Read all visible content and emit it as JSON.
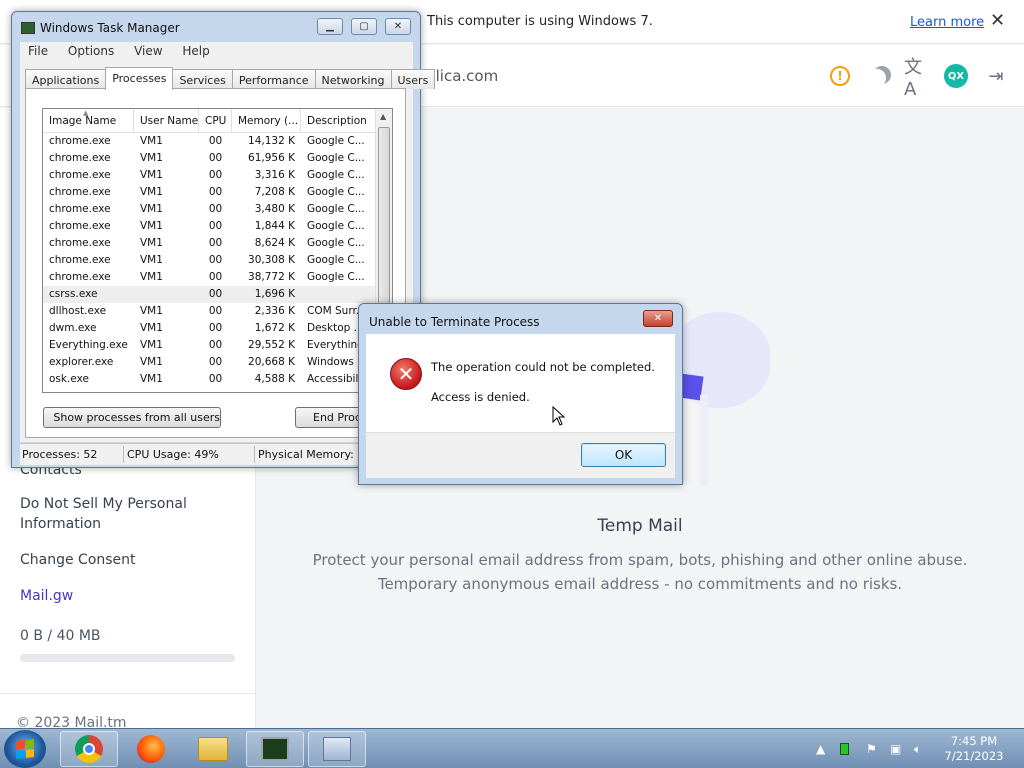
{
  "browser": {
    "notice": {
      "text": "This computer is using Windows 7.",
      "link": "Learn more",
      "close_glyph": "✕"
    },
    "header": {
      "domain_partial": "xelica.com",
      "avatar_initials": "QX",
      "icons": [
        "warning-icon",
        "moon-icon",
        "translate-icon",
        "avatar",
        "logout-icon"
      ]
    },
    "sidebar": {
      "contacts": "Contacts",
      "do_not_sell": "Do Not Sell My Personal Information",
      "change_consent": "Change Consent",
      "mail_gw": "Mail.gw",
      "storage": "0 B  / 40 MB",
      "storage_fraction": 0,
      "copyright": "© 2023 Mail.tm"
    },
    "main": {
      "title": "Temp Mail",
      "desc_line1": "Protect your personal email address from spam, bots, phishing and other online abuse.",
      "desc_line2": "Temporary anonymous email address - no commitments and no risks."
    }
  },
  "task_manager": {
    "title": "Windows Task Manager",
    "menu": [
      "File",
      "Options",
      "View",
      "Help"
    ],
    "tabs": [
      "Applications",
      "Processes",
      "Services",
      "Performance",
      "Networking",
      "Users"
    ],
    "active_tab": "Processes",
    "columns": [
      "Image Name",
      "User Name",
      "CPU",
      "Memory (...",
      "Description"
    ],
    "rows": [
      {
        "name": "chrome.exe",
        "user": "VM1",
        "cpu": "00",
        "mem": "14,132 K",
        "desc": "Google C..."
      },
      {
        "name": "chrome.exe",
        "user": "VM1",
        "cpu": "00",
        "mem": "61,956 K",
        "desc": "Google C..."
      },
      {
        "name": "chrome.exe",
        "user": "VM1",
        "cpu": "00",
        "mem": "3,316 K",
        "desc": "Google C..."
      },
      {
        "name": "chrome.exe",
        "user": "VM1",
        "cpu": "00",
        "mem": "7,208 K",
        "desc": "Google C..."
      },
      {
        "name": "chrome.exe",
        "user": "VM1",
        "cpu": "00",
        "mem": "3,480 K",
        "desc": "Google C..."
      },
      {
        "name": "chrome.exe",
        "user": "VM1",
        "cpu": "00",
        "mem": "1,844 K",
        "desc": "Google C..."
      },
      {
        "name": "chrome.exe",
        "user": "VM1",
        "cpu": "00",
        "mem": "8,624 K",
        "desc": "Google C..."
      },
      {
        "name": "chrome.exe",
        "user": "VM1",
        "cpu": "00",
        "mem": "30,308 K",
        "desc": "Google C..."
      },
      {
        "name": "chrome.exe",
        "user": "VM1",
        "cpu": "00",
        "mem": "38,772 K",
        "desc": "Google C..."
      },
      {
        "name": "csrss.exe",
        "user": "",
        "cpu": "00",
        "mem": "1,696 K",
        "desc": "",
        "selected": true
      },
      {
        "name": "dllhost.exe",
        "user": "VM1",
        "cpu": "00",
        "mem": "2,336 K",
        "desc": "COM Surr..."
      },
      {
        "name": "dwm.exe",
        "user": "VM1",
        "cpu": "00",
        "mem": "1,672 K",
        "desc": "Desktop ..."
      },
      {
        "name": "Everything.exe",
        "user": "VM1",
        "cpu": "00",
        "mem": "29,552 K",
        "desc": "Everything"
      },
      {
        "name": "explorer.exe",
        "user": "VM1",
        "cpu": "00",
        "mem": "20,668 K",
        "desc": "Windows ..."
      },
      {
        "name": "osk.exe",
        "user": "VM1",
        "cpu": "00",
        "mem": "4,588 K",
        "desc": "Accessibili..."
      }
    ],
    "show_all_button": "Show processes from all users",
    "end_process_button": "End Process",
    "status": {
      "processes": "Processes: 52",
      "cpu": "CPU Usage: 49%",
      "memory": "Physical Memory: 3"
    }
  },
  "dialog": {
    "title": "Unable to Terminate Process",
    "message": "The operation could not be completed.",
    "detail": "Access is denied.",
    "ok": "OK",
    "close_glyph": "✕"
  },
  "taskbar": {
    "apps": [
      "chrome-icon",
      "firefox-icon",
      "file-explorer-icon",
      "task-manager-icon",
      "remote-desktop-icon"
    ],
    "time": "7:45 PM",
    "date": "7/21/2023",
    "show_hidden_glyph": "▲"
  }
}
